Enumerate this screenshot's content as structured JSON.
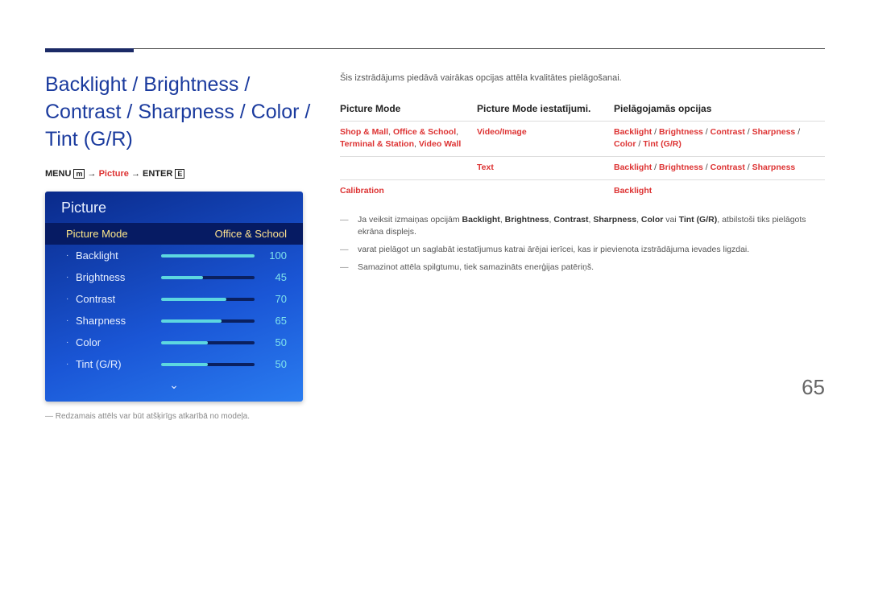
{
  "page_number": "65",
  "title": "Backlight / Brightness / Contrast / Sharpness / Color / Tint (G/R)",
  "breadcrumb": {
    "prefix": "MENU",
    "menu_icon": "m",
    "arrow1": " → ",
    "item": "Picture",
    "arrow2": " → ",
    "suffix": "ENTER",
    "enter_icon": "E"
  },
  "osd": {
    "header": "Picture",
    "selected": {
      "label": "Picture Mode",
      "value": "Office & School"
    },
    "rows": [
      {
        "label": "Backlight",
        "value": "100",
        "pct": 100
      },
      {
        "label": "Brightness",
        "value": "45",
        "pct": 45
      },
      {
        "label": "Contrast",
        "value": "70",
        "pct": 70
      },
      {
        "label": "Sharpness",
        "value": "65",
        "pct": 65
      },
      {
        "label": "Color",
        "value": "50",
        "pct": 50
      },
      {
        "label": "Tint (G/R)",
        "value": "50",
        "pct": 50
      }
    ],
    "chevron": "⌄",
    "note_dash": "―",
    "note": "Redzamais attēls var būt atšķirīgs atkarībā no modeļa."
  },
  "right": {
    "intro": "Šis izstrādājums piedāvā vairākas opcijas attēla kvalitātes pielāgošanai.",
    "headers": {
      "c1": "Picture Mode",
      "c2": "Picture Mode iestatījumi.",
      "c3": "Pielāgojamās opcijas"
    },
    "table": [
      {
        "c1_parts": [
          "Shop & Mall",
          ", ",
          "Office & School",
          ", ",
          "Terminal & Station",
          ", ",
          "Video Wall"
        ],
        "c2_parts": [
          "Video/Image"
        ],
        "c3_parts": [
          "Backlight",
          " /  ",
          "Brightness",
          " / ",
          "Contrast",
          " / ",
          "Sharpness",
          " / ",
          "Color",
          " / ",
          "Tint (G/R)"
        ]
      },
      {
        "c1_parts": [],
        "c2_parts": [
          "Text"
        ],
        "c3_parts": [
          "Backlight",
          " / ",
          "Brightness",
          " / ",
          "Contrast",
          " / ",
          "Sharpness"
        ]
      },
      {
        "c1_parts": [
          "Calibration"
        ],
        "c2_parts": [],
        "c3_parts": [
          "Backlight"
        ]
      }
    ],
    "notes": [
      {
        "pre": "Ja veiksit izmaiņas opcijām ",
        "bold_parts": [
          "Backlight",
          ", ",
          "Brightness",
          ", ",
          "Contrast",
          ", ",
          "Sharpness",
          ", ",
          "Color",
          " vai ",
          "Tint (G/R)"
        ],
        "post": ", atbilstoši tiks pielāgots ekrāna displejs."
      },
      {
        "text": "varat pielāgot un saglabāt iestatījumus katrai ārējai ierīcei, kas ir pievienota izstrādājuma ievades ligzdai."
      },
      {
        "text": "Samazinot attēla spilgtumu, tiek samazināts enerģijas patēriņš."
      }
    ]
  }
}
